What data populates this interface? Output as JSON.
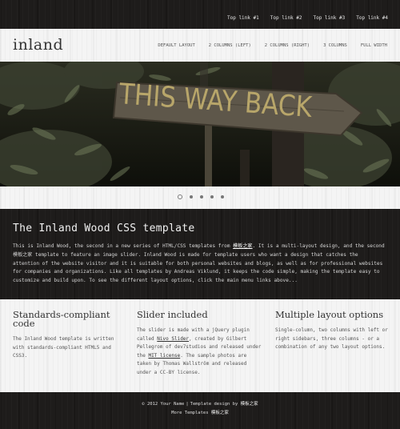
{
  "top_links": [
    "Top link #1",
    "Top link #2",
    "Top link #3",
    "Top link #4"
  ],
  "logo": "inland",
  "nav": [
    "DEFAULT LAYOUT",
    "2 COLUMNS (LEFT)",
    "2 COLUMNS (RIGHT)",
    "3 COLUMNS",
    "FULL WIDTH"
  ],
  "banner": {
    "sign_text": "THIS WAY BACK"
  },
  "slider": {
    "active_index": 0,
    "count": 5
  },
  "intro": {
    "title": "The Inland Wood CSS template",
    "text_1": "This is Inland Wood, the second in a new series of HTML/CSS templates from ",
    "link": "模板之家",
    "text_2": ". It is a multi-layout design, and the second 模板之家 template to feature an image slider. Inland Wood is made for template users who want a design that catches the attention of the website visitor and it is suitable for both personal websites and blogs, as well as for professional websites for companies and organizations. Like all templates by Andreas Viklund, it keeps the code simple, making the template easy to customize and build upon. To see the different layout options, click the main menu links above..."
  },
  "columns": [
    {
      "title": "Standards-compliant code",
      "text": "The Inland Wood template is written with standards-compliant HTML5 and CSS3."
    },
    {
      "title": "Slider included",
      "text_1": "The slider is made with a jQuery plugin called ",
      "link_1": "Nivo Slider",
      "text_2": ", created by Gilbert Pellegrom of dev7studios and released under the ",
      "link_2": "MIT license",
      "text_3": ". The sample photos are taken by Thomas Wallström and released under a CC-BY license."
    },
    {
      "title": "Multiple layout options",
      "text": "Single-column, two columns with left or right sidebars, three columns - or a combination of any two layout options."
    }
  ],
  "footer": {
    "copyright": "© 2012 Your Name",
    "divider": "|",
    "design_text": "Template design by",
    "design_link": "模板之家",
    "more_text": "More Templates",
    "more_link": "模板之家"
  },
  "colors": {
    "wood_dark": "#1e1c1b",
    "panel_light": "#f4f4f4",
    "sign_text": "#b8a66a"
  }
}
